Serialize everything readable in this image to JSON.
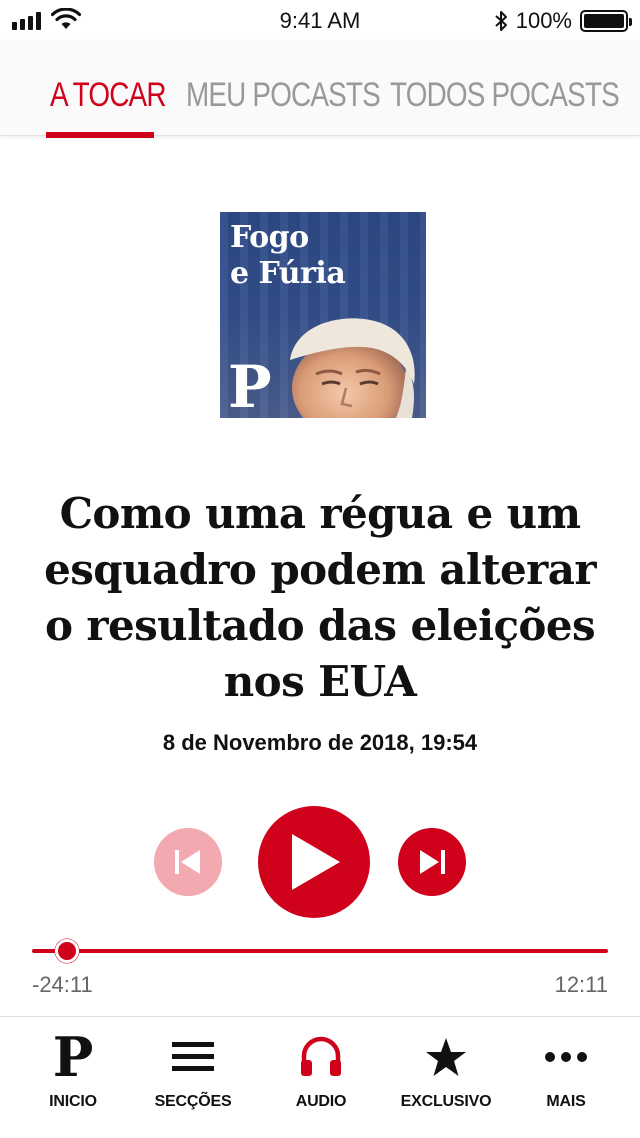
{
  "status_bar": {
    "time": "9:41 AM",
    "battery": "100%",
    "icons": [
      "signal-icon",
      "wifi-icon",
      "bluetooth-icon",
      "battery-icon"
    ]
  },
  "tabs": [
    {
      "label": "A TOCAR",
      "active": true
    },
    {
      "label": "MEU POCASTS",
      "active": false
    },
    {
      "label": "TODOS POCASTS",
      "active": false
    }
  ],
  "podcast": {
    "artwork_title_line1": "Fogo",
    "artwork_title_line2": "e Fúria",
    "artwork_logo": "P"
  },
  "episode": {
    "title": "Como uma régua e um esquadro podem alterar o resultado das eleições nos EUA",
    "date": "8 de Novembro de 2018, 19:54"
  },
  "player": {
    "time_remaining": "-24:11",
    "duration": "12:11",
    "progress": 0.06
  },
  "bottom_nav": [
    {
      "label": "INICIO",
      "icon": "p-logo-icon"
    },
    {
      "label": "SECÇÕES",
      "icon": "hamburger-menu-icon"
    },
    {
      "label": "AUDIO",
      "icon": "headphones-icon",
      "active": true
    },
    {
      "label": "EXCLUSIVO",
      "icon": "star-icon"
    },
    {
      "label": "MAIS",
      "icon": "more-dots-icon"
    }
  ],
  "colors": {
    "accent": "#d0021b",
    "accent_disabled": "#f2a9b0",
    "inactive_tab": "#999999"
  }
}
